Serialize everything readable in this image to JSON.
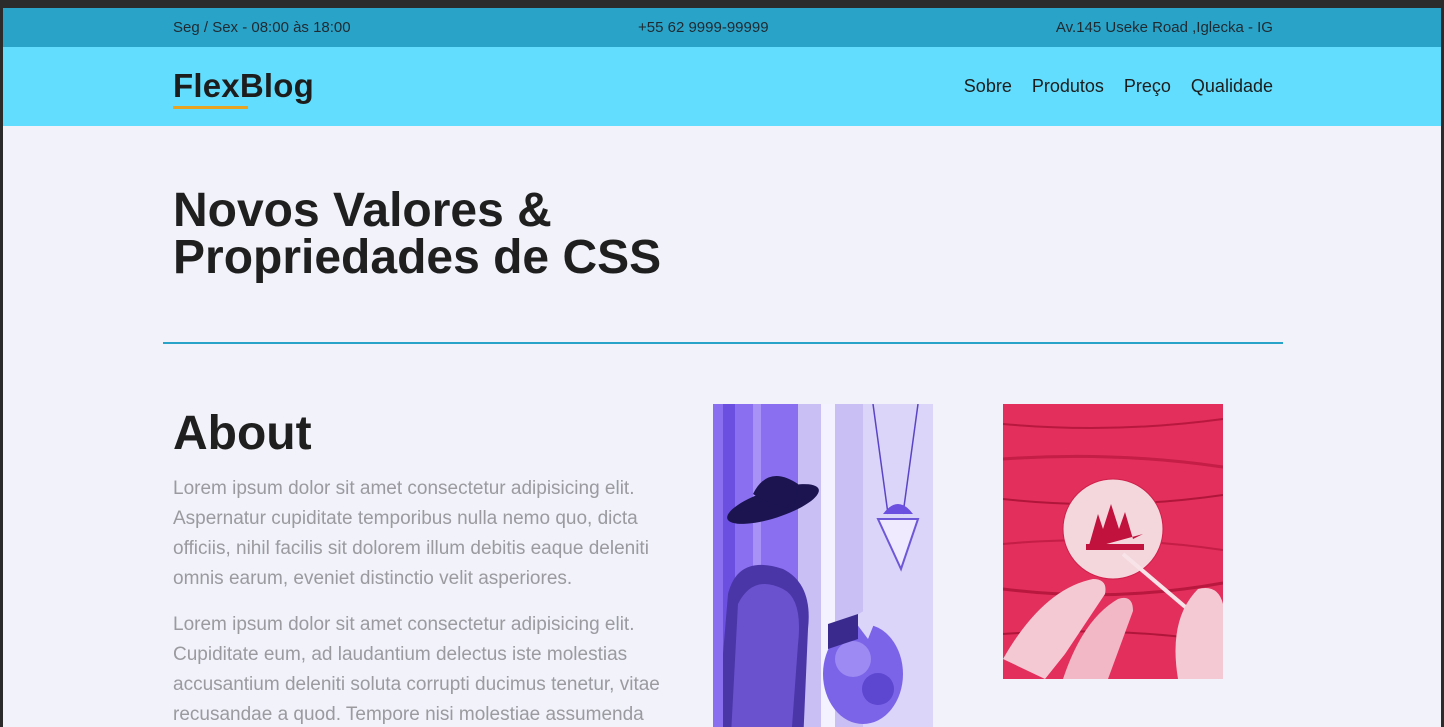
{
  "topbar": {
    "hours": "Seg / Sex - 08:00 às 18:00",
    "phone": "+55 62 9999-99999",
    "address": "Av.145 Useke Road ,Iglecka - IG"
  },
  "navbar": {
    "logo": "FlexBlog",
    "links": [
      "Sobre",
      "Produtos",
      "Preço",
      "Qualidade"
    ]
  },
  "hero": {
    "title": "Novos Valores & Propriedades de CSS"
  },
  "about": {
    "heading": "About",
    "paragraphs": [
      "Lorem ipsum dolor sit amet consectetur adipisicing elit. Aspernatur cupiditate temporibus nulla nemo quo, dicta officiis, nihil facilis sit dolorem illum debitis eaque deleniti omnis earum, eveniet distinctio velit asperiores.",
      "Lorem ipsum dolor sit amet consectetur adipisicing elit. Cupiditate eum, ad laudantium delectus iste molestias accusantium deleniti soluta corrupti ducimus tenetur, vitae recusandae a quod. Tempore nisi molestiae assumenda"
    ]
  },
  "colors": {
    "topbar": "#2aa3c9",
    "navbar": "#62ddfd",
    "accent": "#e8a320",
    "background": "#f1f2fa"
  },
  "images": {
    "photo1": "woman-in-hat-photo",
    "photo2": "painting-on-wood-photo"
  }
}
